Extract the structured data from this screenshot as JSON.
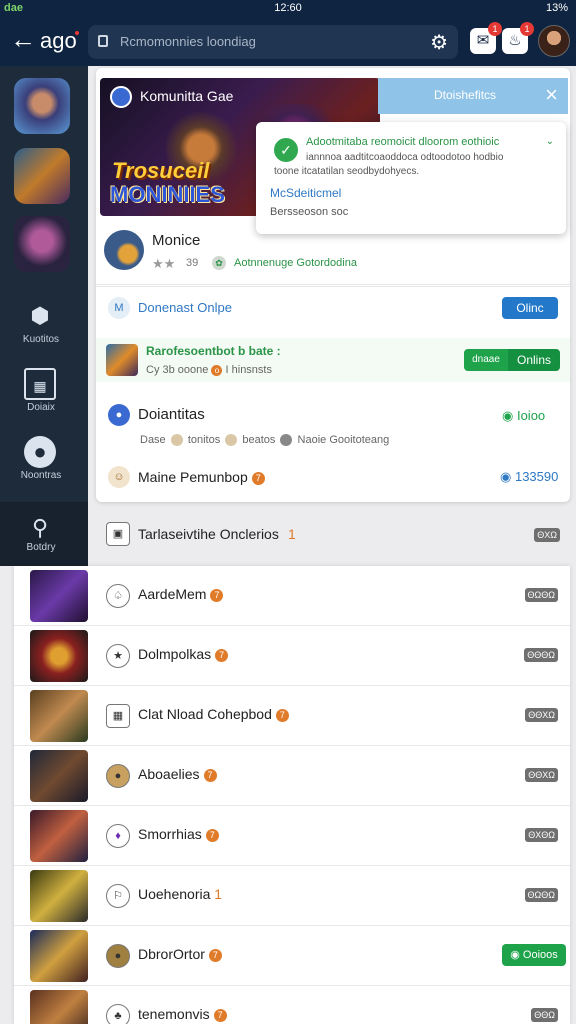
{
  "status": {
    "left": "dae",
    "time": "12:60",
    "right": "13%"
  },
  "header": {
    "brand": "ago",
    "search_placeholder": "Rcmomonnies loondiag",
    "notif_badge_1": "1",
    "notif_badge_2": "1"
  },
  "rail": {
    "items": [
      {
        "label": ""
      },
      {
        "label": ""
      },
      {
        "label": ""
      },
      {
        "label": "Kuotitos"
      },
      {
        "label": "Doiaix"
      },
      {
        "label": "Noontras"
      },
      {
        "label": "Botdry"
      }
    ]
  },
  "banner": {
    "title": "Komunitta Gae",
    "logo_line1": "Trosuceil",
    "logo_line2": "MONINIIES",
    "chip_label": "Dtoishefitcs"
  },
  "popup": {
    "heading": "Adootmitaba reomoicit dloorom eothioic",
    "body_line1": "iannnoa aadtitcoaoddoca odtoodotoo hodbio",
    "body_line2": "toone itcatatilan seodbydohyecs.",
    "link": "McSdeiticmel",
    "footer": "Bersseoson soc"
  },
  "game": {
    "title": "Monice",
    "rating_count": "39",
    "tag": "Aotnnenuge Gotordodina"
  },
  "rows": {
    "broadcast_label": "Donenast Onlpe",
    "broadcast_button": "Olinc",
    "highlight_title": "Rarofesoentbot b bate :",
    "highlight_sub_a": "Cy 3b ooone",
    "highlight_sub_b": "I hinsnsts",
    "highlight_btn_a": "dnaae",
    "highlight_btn_b": "Onlins",
    "section_title": "Doiantitas",
    "section_status": "Ioioo",
    "section_sub_1": "Dase",
    "section_sub_2": "tonitos",
    "section_sub_3": "beatos",
    "section_sub_4": "Naoie Gooitoteang",
    "member_label": "Maine Pemunbop",
    "member_count": "133590"
  },
  "list": {
    "header": {
      "label": "Tarlaseivtihe Onclerios",
      "count": "1",
      "stat": "ΘΧΩ"
    },
    "items": [
      {
        "label": "AardeMem",
        "badge": "7",
        "stat": "ΘΩΘΩ"
      },
      {
        "label": "Dolmpolkas",
        "badge": "7",
        "stat": "ΘΘΘΩ"
      },
      {
        "label": "Clat Nload Cohepbod",
        "badge": "7",
        "stat": "ΘΘΧΩ"
      },
      {
        "label": "Aboaelies",
        "badge": "7",
        "stat": "ΘΘΧΩ"
      },
      {
        "label": "Smorrhias",
        "badge": "7",
        "stat": "ΘΧΘΩ"
      },
      {
        "label": "Uoehenoria",
        "badge": "1",
        "stat": "ΘΩΘΩ"
      },
      {
        "label": "DbrorOrtor",
        "badge": "7",
        "pill": "Ooioos"
      },
      {
        "label": "tenemonvis",
        "badge": "7",
        "stat": "ΘΘΩ"
      }
    ]
  },
  "colors": {
    "topbar": "#0f2440",
    "rail": "#1e2b3a",
    "accent_green": "#1ea24a",
    "accent_blue": "#2f78c4",
    "badge_orange": "#e07b2a"
  }
}
